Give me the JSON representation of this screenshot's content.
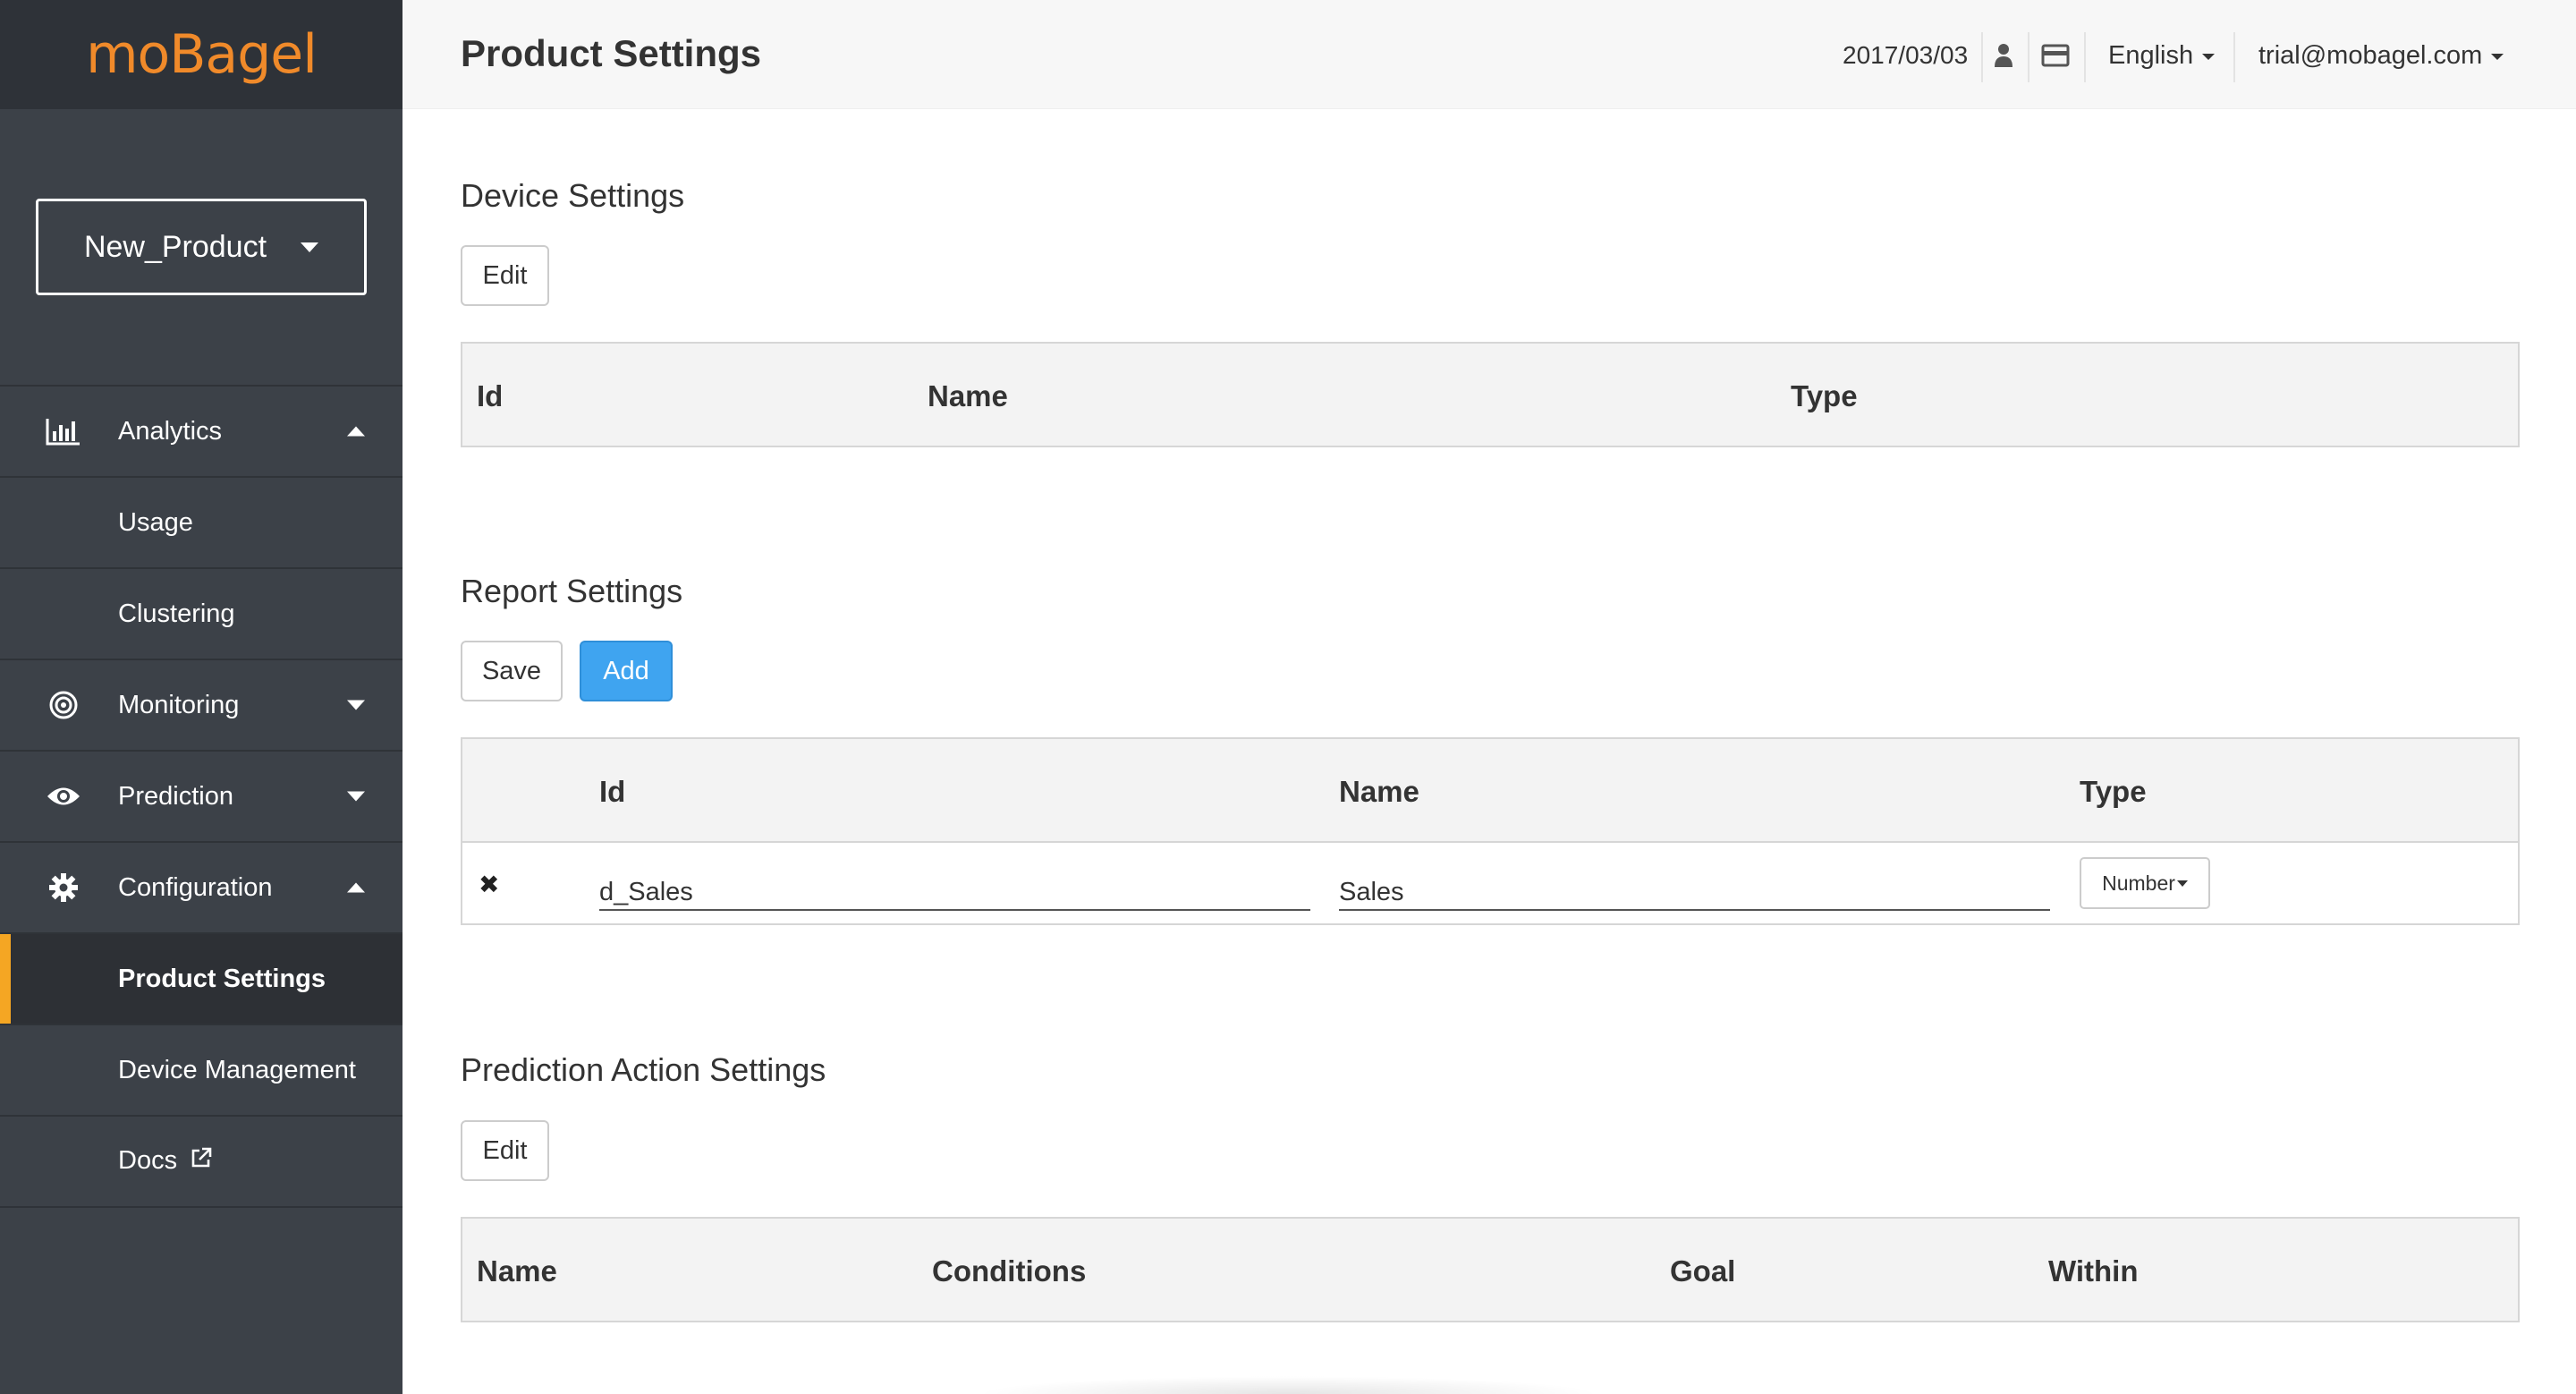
{
  "brand": {
    "logo_text": "moBagel",
    "logo_color": "#f08a2a"
  },
  "sidebar": {
    "product_selector": {
      "value": "New_Product"
    },
    "items": [
      {
        "label": "Analytics",
        "icon": "bar-chart-icon",
        "expanded": true
      },
      {
        "label": "Usage"
      },
      {
        "label": "Clustering"
      },
      {
        "label": "Monitoring",
        "icon": "target-icon",
        "expanded": false
      },
      {
        "label": "Prediction",
        "icon": "eye-icon",
        "expanded": false
      },
      {
        "label": "Configuration",
        "icon": "gear-icon",
        "expanded": true
      },
      {
        "label": "Product Settings",
        "active": true
      },
      {
        "label": "Device Management"
      },
      {
        "label": "Docs",
        "icon": "external-link-icon"
      }
    ],
    "active_color": "#f5a623"
  },
  "header": {
    "title": "Product Settings",
    "date": "2017/03/03",
    "language": "English",
    "user_email": "trial@mobagel.com"
  },
  "device_settings": {
    "title": "Device Settings",
    "edit_label": "Edit",
    "columns": [
      "Id",
      "Name",
      "Type"
    ]
  },
  "report_settings": {
    "title": "Report Settings",
    "save_label": "Save",
    "add_label": "Add",
    "columns": [
      "Id",
      "Name",
      "Type"
    ],
    "rows": [
      {
        "id": "d_Sales",
        "name": "Sales",
        "type": "Number"
      }
    ],
    "accent_color": "#3fa4f0"
  },
  "prediction_action_settings": {
    "title": "Prediction Action Settings",
    "edit_label": "Edit",
    "columns": [
      "Name",
      "Conditions",
      "Goal",
      "Within"
    ]
  }
}
